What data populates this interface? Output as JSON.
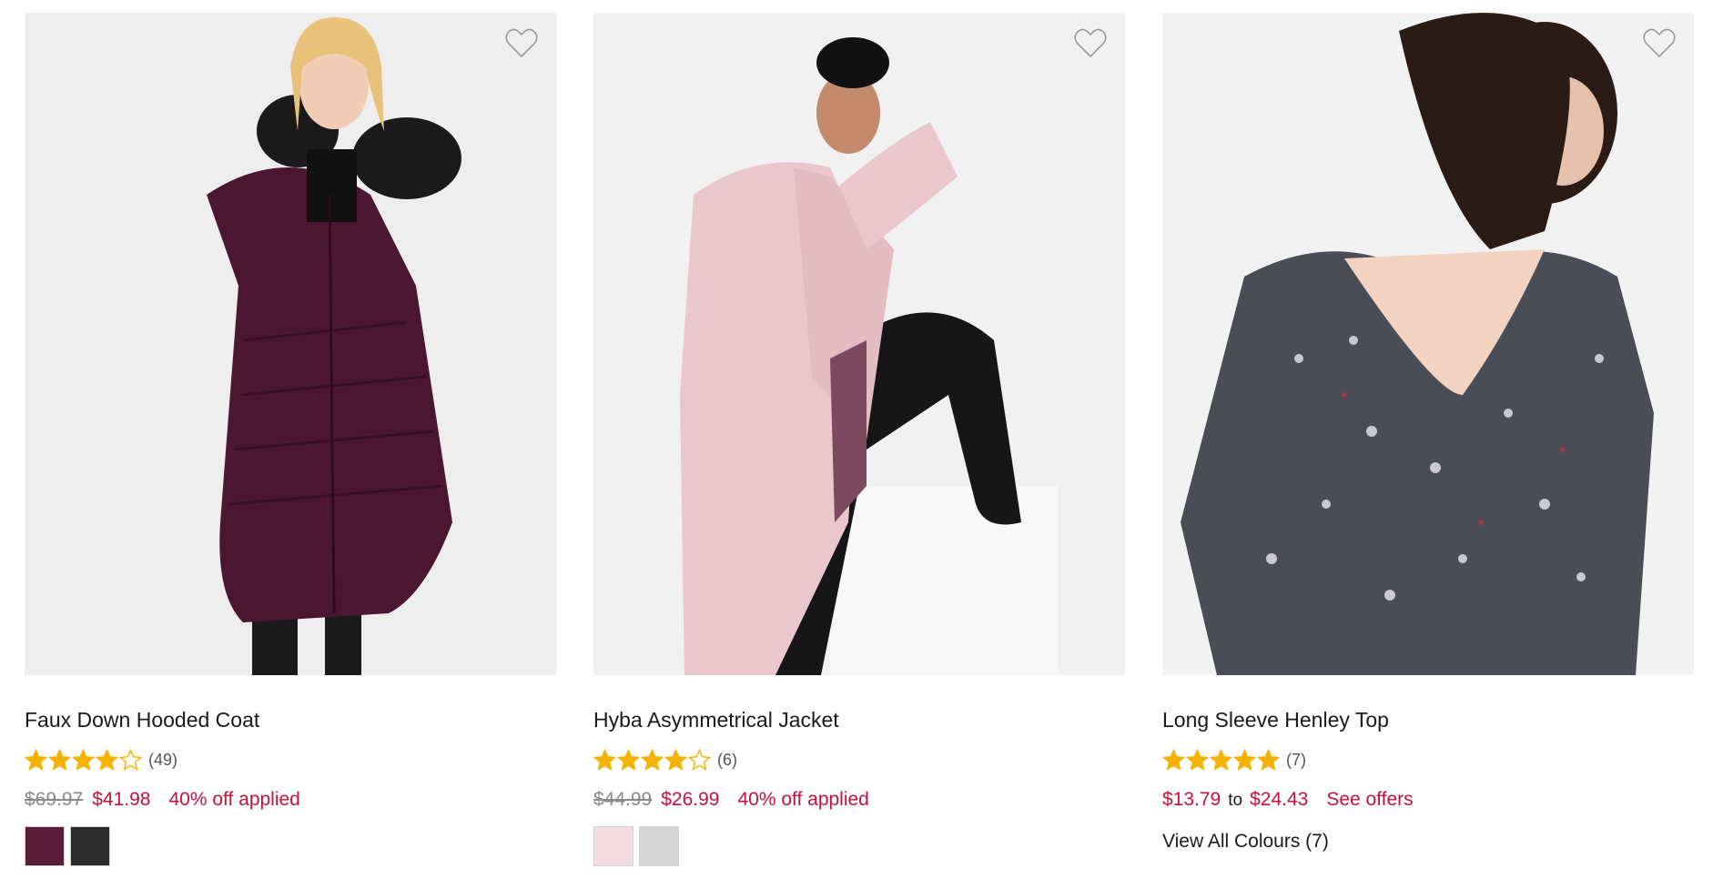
{
  "products": [
    {
      "name": "Faux Down Hooded Coat",
      "rating_count": "(49)",
      "stars": [
        1,
        1,
        1,
        1,
        0
      ],
      "old_price": "$69.97",
      "sale_price": "$41.98",
      "promo": "40% off applied",
      "swatch_colors": [
        "#5a1d38",
        "#2b2b2b"
      ]
    },
    {
      "name": "Hyba Asymmetrical Jacket",
      "rating_count": "(6)",
      "stars": [
        1,
        1,
        1,
        1,
        0
      ],
      "old_price": "$44.99",
      "sale_price": "$26.99",
      "promo": "40% off applied",
      "swatch_colors": [
        "#f3dde3",
        "#d6d6d6"
      ]
    },
    {
      "name": "Long Sleeve Henley Top",
      "rating_count": "(7)",
      "stars": [
        1,
        1,
        1,
        1,
        1
      ],
      "price_from": "$13.79",
      "price_to_word": "to",
      "price_to": "$24.43",
      "offers_link": "See offers",
      "view_all": "View All Colours (7)"
    }
  ],
  "icons": {
    "wishlist": "heart-outline-icon",
    "star_full": "star-filled-icon",
    "star_empty": "star-outline-icon"
  },
  "colors": {
    "accent": "#c8103e",
    "star": "#f5b301"
  }
}
